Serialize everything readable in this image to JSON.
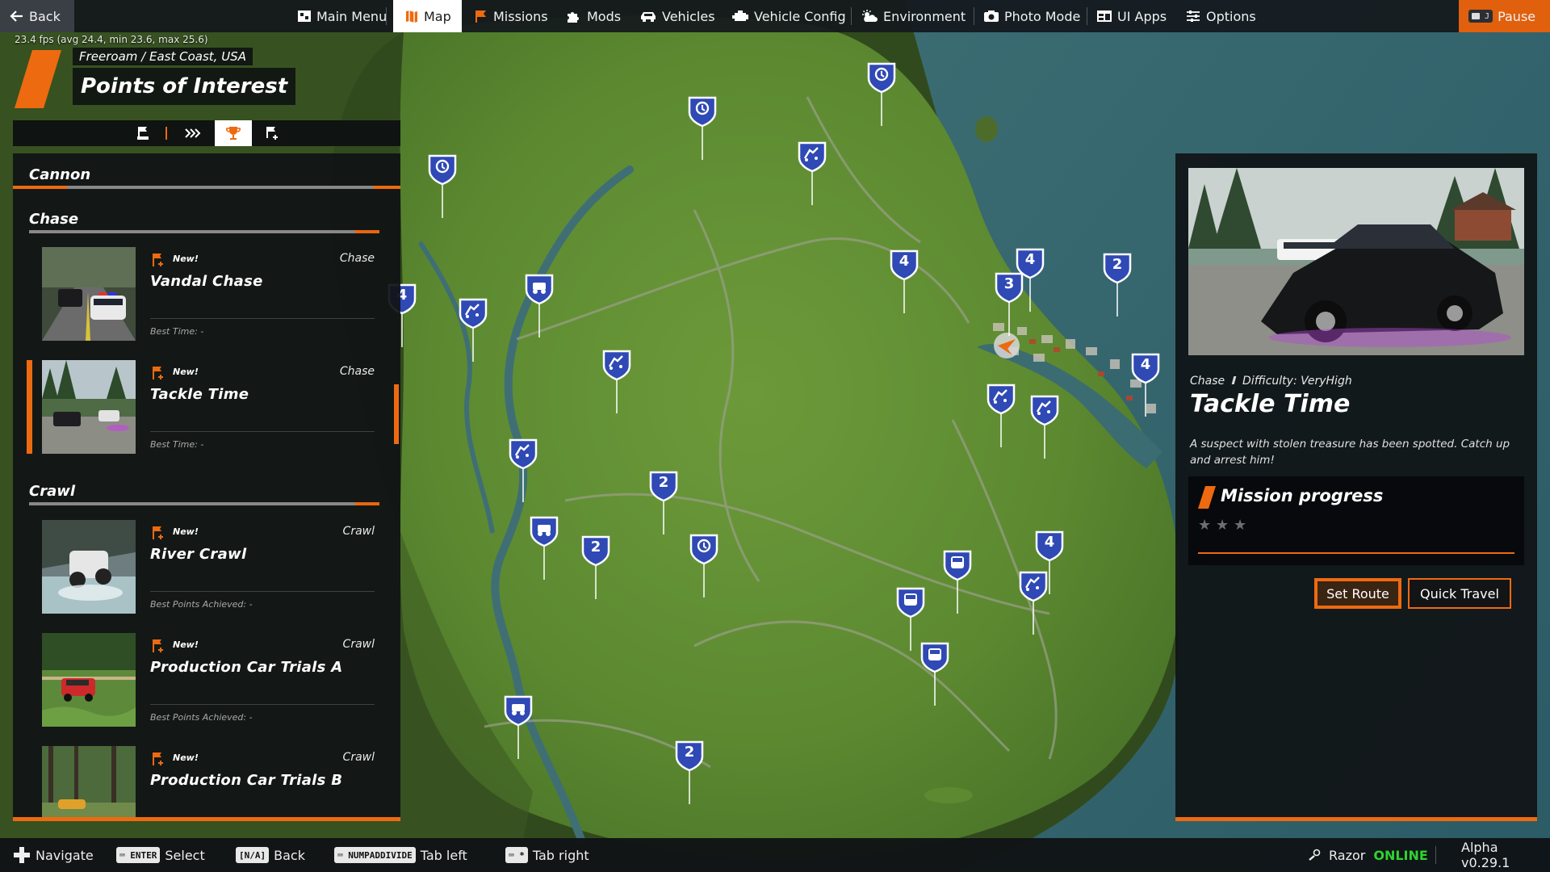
{
  "topbar": {
    "back": "Back",
    "items": [
      {
        "key": "main_menu",
        "label": "Main Menu"
      },
      {
        "key": "map",
        "label": "Map",
        "active": true
      },
      {
        "key": "missions",
        "label": "Missions"
      },
      {
        "key": "mods",
        "label": "Mods"
      },
      {
        "key": "vehicles",
        "label": "Vehicles"
      },
      {
        "key": "vehicle_config",
        "label": "Vehicle Config"
      },
      {
        "key": "environment",
        "label": "Environment"
      },
      {
        "key": "photo_mode",
        "label": "Photo Mode"
      },
      {
        "key": "ui_apps",
        "label": "UI Apps"
      },
      {
        "key": "options",
        "label": "Options"
      }
    ],
    "pause_key": "J",
    "pause": "Pause"
  },
  "header": {
    "fps": "23.4 fps (avg  24.4, min  23.6, max  25.6)",
    "breadcrumb": "Freeroam / East Coast, USA",
    "title": "Points of Interest"
  },
  "list": {
    "categories": [
      {
        "name": "Cannon"
      },
      {
        "name": "Chase"
      },
      {
        "name": "Crawl"
      }
    ],
    "items": [
      {
        "name": "Vandal Chase",
        "type": "Chase",
        "badge": "New!",
        "best": "Best Time: -"
      },
      {
        "name": "Tackle Time",
        "type": "Chase",
        "badge": "New!",
        "best": "Best Time: -",
        "selected": true
      },
      {
        "name": "River Crawl",
        "type": "Crawl",
        "badge": "New!",
        "best": "Best Points Achieved: -"
      },
      {
        "name": "Production Car Trials A",
        "type": "Crawl",
        "badge": "New!",
        "best": "Best Points Achieved: -"
      },
      {
        "name": "Production Car Trials B",
        "type": "Crawl",
        "badge": "New!",
        "best": ""
      }
    ]
  },
  "detail": {
    "category": "Chase",
    "difficulty": "Difficulty: VeryHigh",
    "title": "Tackle Time",
    "description": "A suspect with stolen treasure has been spotted. Catch up and arrest him!",
    "progress_title": "Mission progress",
    "stars_earned": 0,
    "stars_total": 3,
    "set_route": "Set Route",
    "quick_travel": "Quick Travel"
  },
  "bottombar": {
    "navigate": "Navigate",
    "enter_key": "ENTER",
    "select": "Select",
    "back_key": "[N/A]",
    "back": "Back",
    "tab_left_key": "NUMPADDIVIDE",
    "tab_left": "Tab left",
    "tab_right_key": "*",
    "tab_right": "Tab right",
    "user": "Razor",
    "status": "ONLINE",
    "version": "Alpha v0.29.1"
  },
  "map": {
    "markers": [
      {
        "kind": "timer",
        "label": ""
      },
      {
        "kind": "timer",
        "label": ""
      },
      {
        "kind": "timer",
        "label": ""
      },
      {
        "kind": "drift",
        "label": ""
      },
      {
        "kind": "num",
        "label": "4"
      },
      {
        "kind": "drift",
        "label": ""
      },
      {
        "kind": "crawl",
        "label": ""
      },
      {
        "kind": "num",
        "label": "4"
      },
      {
        "kind": "num",
        "label": "4"
      },
      {
        "kind": "num",
        "label": "3"
      },
      {
        "kind": "num",
        "label": "2"
      },
      {
        "kind": "num",
        "label": "4"
      },
      {
        "kind": "drift",
        "label": ""
      },
      {
        "kind": "drift",
        "label": ""
      },
      {
        "kind": "drift",
        "label": ""
      },
      {
        "kind": "drift",
        "label": ""
      },
      {
        "kind": "num",
        "label": "2"
      },
      {
        "kind": "crawl",
        "label": ""
      },
      {
        "kind": "num",
        "label": "2"
      },
      {
        "kind": "timer",
        "label": ""
      },
      {
        "kind": "bus",
        "label": ""
      },
      {
        "kind": "num",
        "label": "4"
      },
      {
        "kind": "drift",
        "label": ""
      },
      {
        "kind": "bus",
        "label": ""
      },
      {
        "kind": "bus",
        "label": ""
      },
      {
        "kind": "crawl",
        "label": ""
      },
      {
        "kind": "num",
        "label": "2"
      }
    ],
    "colors": {
      "marker": "#2f49b5",
      "accent": "#ee6a10"
    }
  }
}
